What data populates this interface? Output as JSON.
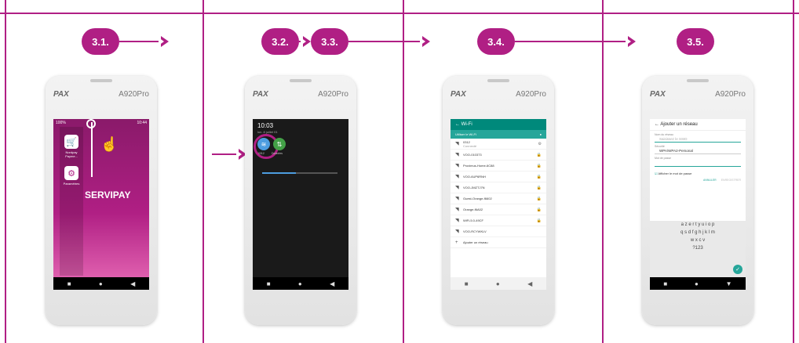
{
  "steps": [
    "3.1.",
    "3.2.",
    "3.3.",
    "3.4.",
    "3.5."
  ],
  "colors": {
    "accent": "#b01f84",
    "teal": "#00897b"
  },
  "device": {
    "brand": "PAX",
    "model": "A920Pro"
  },
  "screen1": {
    "status_battery": "100%",
    "status_time": "10:44",
    "app1_label": "Nordpay Payme...",
    "app2_label": "Paramètres",
    "servipay": "SERVIPAY"
  },
  "screen2": {
    "time": "10:03",
    "date": "lun. 8 juillet 01",
    "wifi_label": "0312",
    "data_label": "Données"
  },
  "screen3": {
    "title": "Wi-Fi",
    "use_wifi": "Utiliser le Wi-Fi",
    "networks": [
      {
        "name": "0312",
        "status": "Connecté"
      },
      {
        "name": "VOO-010373",
        "status": ""
      },
      {
        "name": "Proximus-Home-6C88",
        "status": ""
      },
      {
        "name": "VOO-6UP6RNH",
        "status": ""
      },
      {
        "name": "VOO-JMZTJ7N",
        "status": ""
      },
      {
        "name": "Guest-Orange-f6602",
        "status": ""
      },
      {
        "name": "Orange-f6A02",
        "status": ""
      },
      {
        "name": "WiFi-5.0-49CF",
        "status": ""
      },
      {
        "name": "VOO-RCYWKLV",
        "status": ""
      }
    ],
    "add_network": "Ajouter un réseau"
  },
  "screen4": {
    "title": "Ajouter un réseau",
    "ssid_label": "Nom du réseau",
    "ssid_placeholder": "Saisissez le SSID",
    "security_label": "Sécurité",
    "security_value": "WPA/WPA2-Personal",
    "password_label": "Mot de passe",
    "show_password": "Afficher le mot de passe",
    "cancel": "ANNULER",
    "save": "ENREGISTRER",
    "keyboard_rows": [
      "a z e r t y u i o p",
      "q s d f g h j k l m",
      "w x c v"
    ],
    "keyboard_label": "?123"
  }
}
